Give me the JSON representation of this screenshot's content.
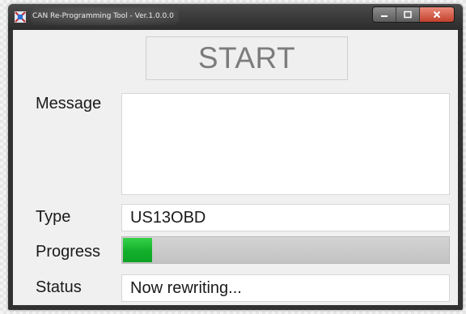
{
  "window": {
    "title": "CAN Re-Programming Tool - Ver.1.0.0.0"
  },
  "start_button": {
    "label": "START"
  },
  "message": {
    "label": "Message",
    "value": ""
  },
  "type": {
    "label": "Type",
    "value": "US13OBD"
  },
  "progress": {
    "label": "Progress",
    "fraction": 0.09,
    "color": "#1db834"
  },
  "status": {
    "label": "Status",
    "value": "Now rewriting..."
  }
}
